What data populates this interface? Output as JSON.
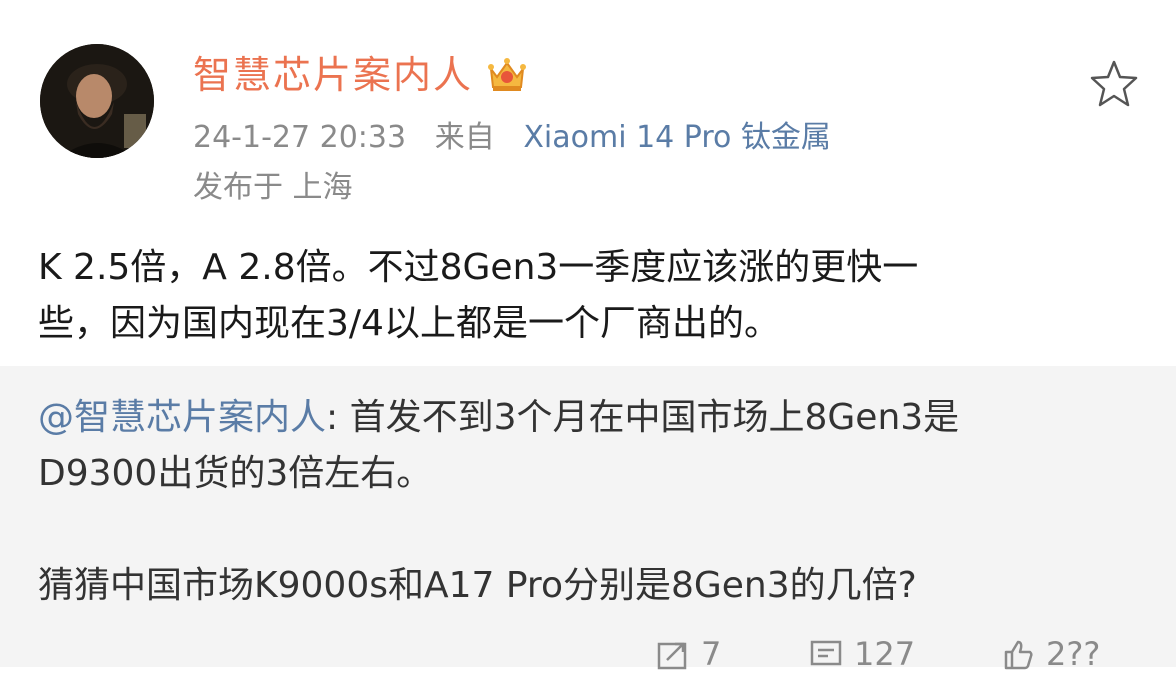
{
  "post": {
    "author": "智慧芯片案内人",
    "timestamp": "24-1-27 20:33",
    "source_prefix": "来自",
    "device": "Xiaomi 14 Pro 钛金属",
    "location": "发布于 上海",
    "body_line1": "K 2.5倍，A 2.8倍。不过8Gen3一季度应该涨的更快一",
    "body_line2": "些，因为国内现在3/4以上都是一个厂商出的。"
  },
  "repost": {
    "mention": "@智慧芯片案内人",
    "text_line1": ": 首发不到3个月在中国市场上8Gen3是",
    "text_line2": "D9300出货的3倍左右。",
    "text_line3": "猜猜中国市场K9000s和A17 Pro分别是8Gen3的几倍?"
  },
  "actions": {
    "repost_count": "7",
    "comment_count": "127",
    "like_count": "2??"
  },
  "icons": {
    "vip": "crown-badge-icon",
    "favorite": "star-outline-icon",
    "repost": "repost-icon",
    "comment": "comment-icon",
    "like": "thumbs-up-icon"
  },
  "colors": {
    "author": "#eb7350",
    "link": "#5a7ca6",
    "meta": "#8a8a8a",
    "repost_bg": "#f4f4f4"
  }
}
